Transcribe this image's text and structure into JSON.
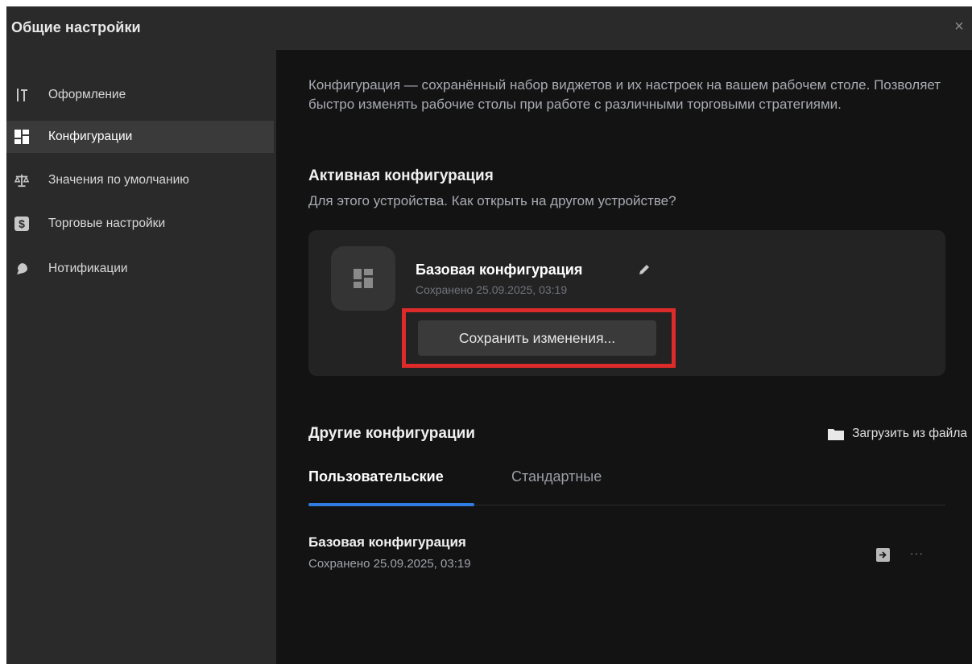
{
  "window": {
    "title": "Общие настройки",
    "close_glyph": "×"
  },
  "sidebar": {
    "items": [
      {
        "label": "Оформление",
        "icon": "appearance-icon",
        "active": false
      },
      {
        "label": "Конфигурации",
        "icon": "layout-icon",
        "active": true
      },
      {
        "label": "Значения по умолчанию",
        "icon": "scales-icon",
        "active": false
      },
      {
        "label": "Торговые настройки",
        "icon": "dollar-icon",
        "active": false
      },
      {
        "label": "Нотификации",
        "icon": "notification-icon",
        "active": false
      }
    ]
  },
  "main": {
    "description": "Конфигурация — сохранённый набор виджетов и их настроек на вашем рабочем столе. Позволяет быстро изменять рабочие столы при работе с различными торговыми стратегиями.",
    "active_title": "Активная конфигурация",
    "active_subtitle": "Для этого устройства. Как открыть на другом устройстве?",
    "active_card": {
      "name": "Базовая конфигурация",
      "saved": "Сохранено 25.09.2025, 03:19",
      "save_button": "Сохранить изменения..."
    },
    "other_title": "Другие конфигурации",
    "load_file_label": "Загрузить из файла",
    "tabs": [
      {
        "label": "Пользовательские",
        "active": true
      },
      {
        "label": "Стандартные",
        "active": false
      }
    ],
    "list": [
      {
        "name": "Базовая конфигурация",
        "saved": "Сохранено 25.09.2025, 03:19",
        "more_glyph": "···"
      }
    ]
  },
  "colors": {
    "accent": "#2f7de1",
    "highlight": "#dd2a2a",
    "background": "#131313",
    "sidebar": "#2a2a2a"
  }
}
